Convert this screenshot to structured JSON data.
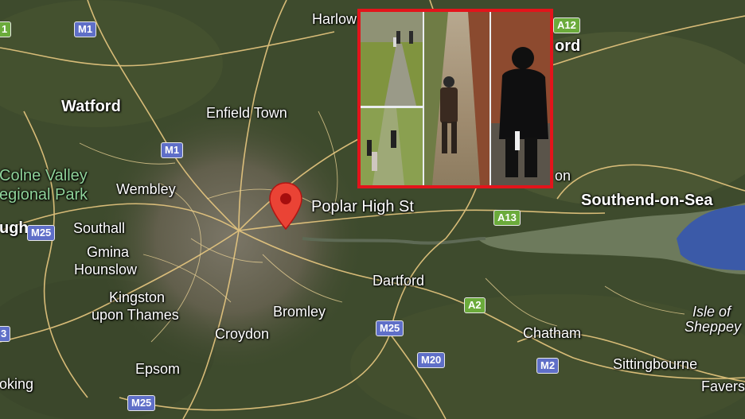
{
  "map": {
    "places": [
      {
        "id": "harlow",
        "label": "Harlow"
      },
      {
        "id": "watford",
        "label": "Watford"
      },
      {
        "id": "enfield",
        "label": "Enfield Town"
      },
      {
        "id": "colne1",
        "label": "Colne Valley"
      },
      {
        "id": "colne2",
        "label": "egional Park"
      },
      {
        "id": "wembley",
        "label": "Wembley"
      },
      {
        "id": "poplar",
        "label": "Poplar High St"
      },
      {
        "id": "southend",
        "label": "Southend-on-Sea"
      },
      {
        "id": "ugh",
        "label": "ugh"
      },
      {
        "id": "southall",
        "label": "Southall"
      },
      {
        "id": "gmina",
        "label": "Gmina"
      },
      {
        "id": "hounslow",
        "label": "Hounslow"
      },
      {
        "id": "dartford",
        "label": "Dartford"
      },
      {
        "id": "kingston1",
        "label": "Kingston"
      },
      {
        "id": "kingston2",
        "label": "upon Thames"
      },
      {
        "id": "bromley",
        "label": "Bromley"
      },
      {
        "id": "croydon",
        "label": "Croydon"
      },
      {
        "id": "chatham",
        "label": "Chatham"
      },
      {
        "id": "sheppey1",
        "label": "Isle of"
      },
      {
        "id": "sheppey2",
        "label": "Sheppey"
      },
      {
        "id": "epsom",
        "label": "Epsom"
      },
      {
        "id": "sittingbourne",
        "label": "Sittingbourne"
      },
      {
        "id": "woking",
        "label": "oking"
      },
      {
        "id": "faversham",
        "label": "Favers"
      },
      {
        "id": "ford",
        "label": "ord"
      },
      {
        "id": "on",
        "label": "on"
      }
    ],
    "roads": [
      {
        "id": "m1a",
        "label": "M1",
        "type": "motorway"
      },
      {
        "id": "m1b",
        "label": "M1",
        "type": "motorway"
      },
      {
        "id": "m25a",
        "label": "M25",
        "type": "motorway"
      },
      {
        "id": "m25b",
        "label": "M25",
        "type": "motorway"
      },
      {
        "id": "m25c",
        "label": "M25",
        "type": "motorway"
      },
      {
        "id": "m20",
        "label": "M20",
        "type": "motorway"
      },
      {
        "id": "m2",
        "label": "M2",
        "type": "motorway"
      },
      {
        "id": "a13",
        "label": "A13",
        "type": "a-road"
      },
      {
        "id": "a2",
        "label": "A2",
        "type": "a-road"
      },
      {
        "id": "a12",
        "label": "A12",
        "type": "a-road"
      },
      {
        "id": "a1",
        "label": "1",
        "type": "a-road"
      },
      {
        "id": "m3",
        "label": "3",
        "type": "motorway"
      }
    ],
    "pin": {
      "icon": "map-pin-icon",
      "color": "#ea4335"
    },
    "inset": {
      "icon": "cctv-stills-image",
      "border_color": "#e3141b"
    }
  }
}
